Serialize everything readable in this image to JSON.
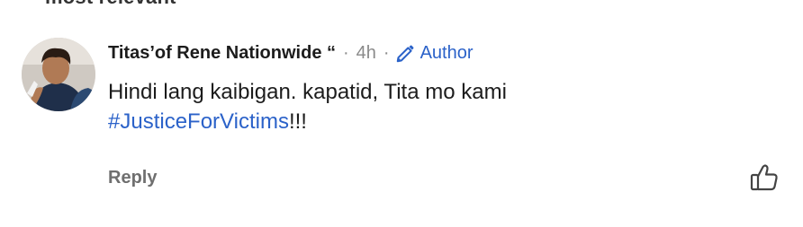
{
  "section_label_partial": "most relevant",
  "comment": {
    "author": "Titas’of Rene Nationwide “",
    "separator": "·",
    "time": "4h",
    "badge_label": "Author",
    "body_line1": "Hindi lang kaibigan. kapatid, Tita mo kami",
    "hashtag": "#JusticeForVictims",
    "hashtag_suffix": "!!!",
    "reply_label": "Reply"
  },
  "colors": {
    "link": "#2b62c9",
    "muted": "#8a8a8a",
    "text": "#1c1c1c"
  },
  "icons": {
    "badge": "pencil-icon",
    "like": "thumbs-up-icon"
  }
}
